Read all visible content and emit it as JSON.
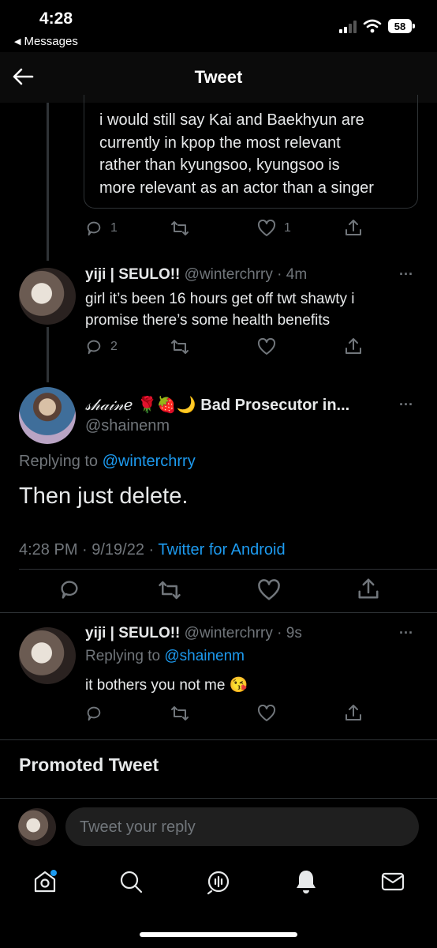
{
  "status_bar": {
    "time": "4:28",
    "back_app": "Messages",
    "battery": "58"
  },
  "header": {
    "title": "Tweet"
  },
  "quoted_tweet": {
    "lines": [
      "i would still say Kai and Baekhyun are",
      "currently in kpop the most relevant",
      "rather than kyungsoo, kyungsoo is",
      "more relevant as an actor than a singer"
    ],
    "reply_count": "1",
    "like_count": "1"
  },
  "tweet1": {
    "name": "yiji | SEULO!!",
    "handle": "@winterchrry",
    "time": "4m",
    "more": "···",
    "lines": [
      "girl it’s been 16 hours get off twt shawty i",
      "promise there’s some health benefits"
    ],
    "reply_count": "2"
  },
  "main_tweet": {
    "name": "𝓈𝒽𝒶𝒾𝓃𝑒",
    "emojis": "🌹🍓🌙",
    "name_rest": "Bad Prosecutor in...",
    "handle": "@shainenm",
    "more": "···",
    "replying_label": "Replying to",
    "replying_to": "@winterchrry",
    "text": "Then just delete.",
    "time_date": "4:28 PM · 9/19/22 ·",
    "source": "Twitter for Android"
  },
  "reply_tweet": {
    "name": "yiji | SEULO!!",
    "handle": "@winterchrry",
    "time": "9s",
    "more": "···",
    "replying_label": "Replying to",
    "replying_to": "@shainenm",
    "text": "it bothers you not me",
    "emoji": "😘"
  },
  "promoted": {
    "label": "Promoted Tweet"
  },
  "reply_box": {
    "placeholder": "Tweet your reply"
  },
  "colors": {
    "background": "#000000",
    "text": "#e7e9ea",
    "muted": "#71767b",
    "link": "#1d9bf0"
  }
}
